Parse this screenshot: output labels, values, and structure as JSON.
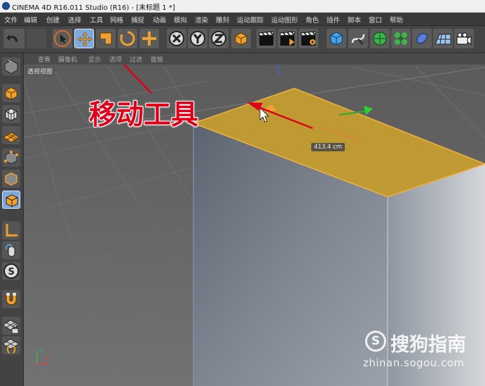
{
  "window": {
    "title": "CINEMA 4D R16.011 Studio (R16) - [未标题 1 *]"
  },
  "menu": [
    "文件",
    "编辑",
    "创建",
    "选择",
    "工具",
    "网格",
    "捕捉",
    "动画",
    "模拟",
    "渲染",
    "雕刻",
    "运动跟踪",
    "运动图形",
    "角色",
    "插件",
    "脚本",
    "窗口",
    "帮助"
  ],
  "viewport": {
    "menu": [
      "查看",
      "摄像机",
      "显示",
      "选项",
      "过滤",
      "面板"
    ],
    "label": "透视视图",
    "measurement": "413.4 cm"
  },
  "annotation": "移动工具",
  "watermark": {
    "logo": "S",
    "text": "搜狗指南",
    "url": "zhinan.sogou.com"
  },
  "axis": {
    "x": "X",
    "y": "Y"
  },
  "colors": {
    "accent": "#f0a030",
    "selection": "#c8a030",
    "annotation": "#e0001a"
  },
  "icons": {
    "toolbar": [
      "undo-icon",
      "select-arrow-icon",
      "move-icon",
      "scale-icon",
      "rotate-icon",
      "transform-icon",
      "x-axis-lock-icon",
      "y-axis-lock-icon",
      "z-axis-lock-icon",
      "world-coordinates-icon",
      "render-view-icon",
      "render-picture-viewer-icon",
      "render-settings-icon",
      "cube-icon",
      "spline-pen-icon",
      "subdivision-surface-icon",
      "cloner-icon",
      "deformer-icon",
      "floor-icon",
      "camera-icon"
    ],
    "sidebar": [
      "model-mode-icon",
      "texture-mode-icon",
      "workplane-mode-icon",
      "points-mode-icon",
      "edges-mode-icon",
      "polygons-mode-icon",
      "axis-mode-icon",
      "tweak-mode-icon",
      "soft-selection-icon",
      "snapping-icon",
      "lock-workplane-icon",
      "quantize-icon"
    ]
  }
}
